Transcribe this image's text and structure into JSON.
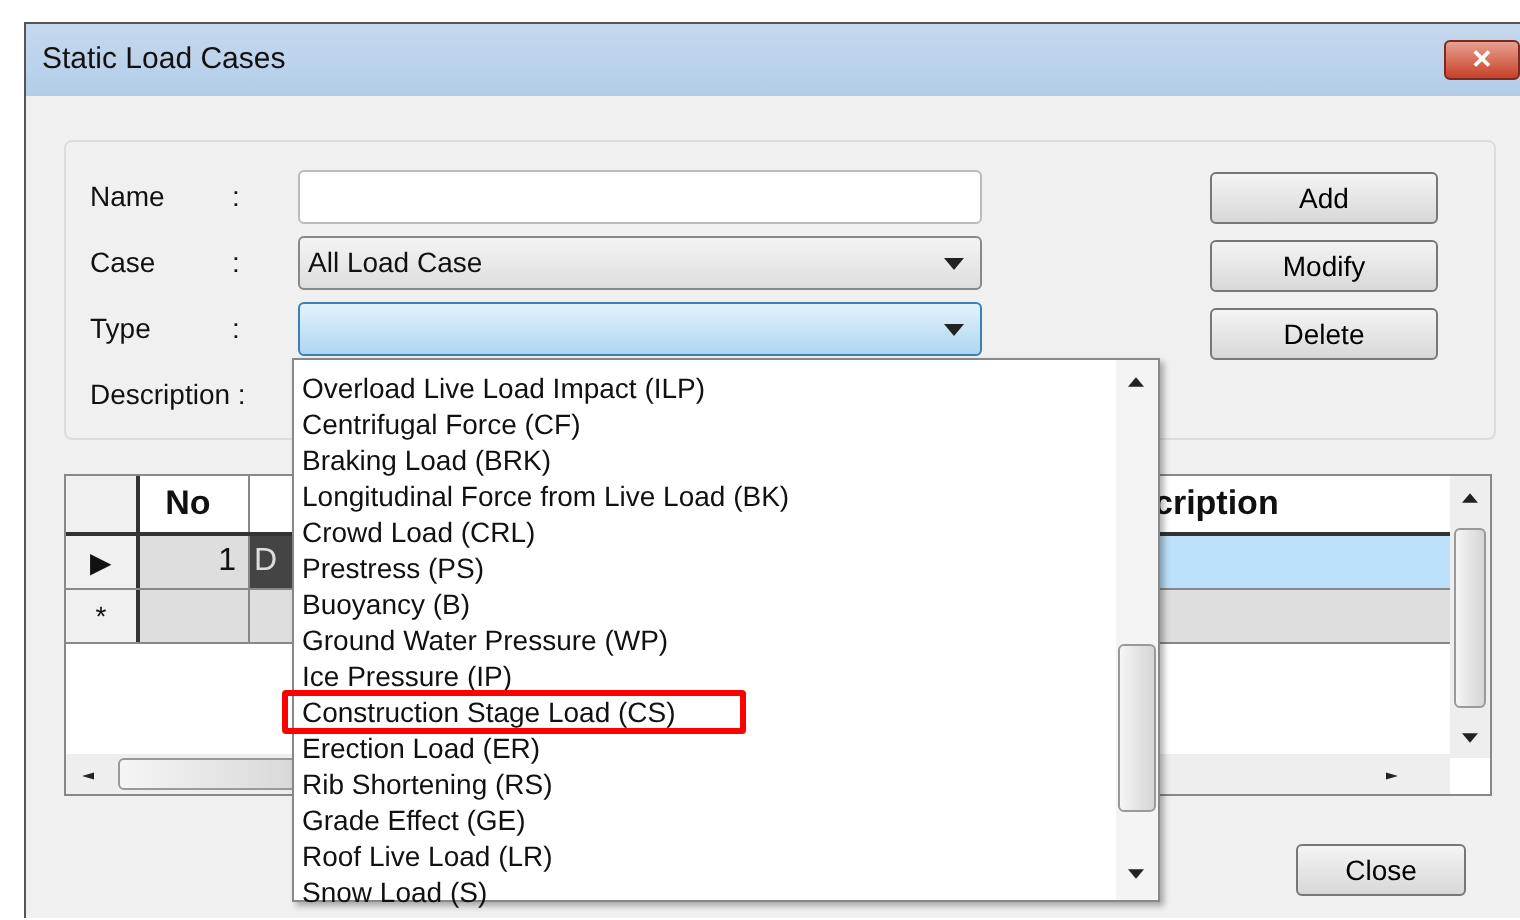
{
  "window": {
    "title": "Static Load Cases",
    "close_glyph": "✕"
  },
  "form": {
    "fields": [
      {
        "label": "Name",
        "sep": ":",
        "kind": "text"
      },
      {
        "label": "Case",
        "sep": ":",
        "kind": "select",
        "value": "All Load Case"
      },
      {
        "label": "Type",
        "sep": ":",
        "kind": "select",
        "open": true
      },
      {
        "label": "Description :",
        "kind": "covered"
      }
    ],
    "buttons": [
      "Add",
      "Modify",
      "Delete"
    ]
  },
  "grid": {
    "columns": [
      "No",
      "cription"
    ],
    "rows": [
      {
        "kind": "data",
        "selector": "▶",
        "no": "1",
        "name": "D",
        "selected": true
      },
      {
        "kind": "new",
        "selector": "*",
        "selected": false
      }
    ]
  },
  "type_dropdown": {
    "items": [
      {
        "label": "Overload Live Load Impact (ILP)",
        "highlighted": false
      },
      {
        "label": "Centrifugal Force (CF)",
        "highlighted": false
      },
      {
        "label": "Braking Load (BRK)",
        "highlighted": false
      },
      {
        "label": "Longitudinal Force from Live Load (BK)",
        "highlighted": false
      },
      {
        "label": "Crowd Load (CRL)",
        "highlighted": false
      },
      {
        "label": "Prestress (PS)",
        "highlighted": false
      },
      {
        "label": "Buoyancy (B)",
        "highlighted": false
      },
      {
        "label": "Ground Water Pressure (WP)",
        "highlighted": false
      },
      {
        "label": "Ice Pressure (IP)",
        "highlighted": false
      },
      {
        "label": "Construction Stage Load (CS)",
        "highlighted": true
      },
      {
        "label": "Erection Load (ER)",
        "highlighted": false
      },
      {
        "label": "Rib Shortening (RS)",
        "highlighted": false
      },
      {
        "label": "Grade Effect (GE)",
        "highlighted": false
      },
      {
        "label": "Roof Live Load (LR)",
        "highlighted": false
      },
      {
        "label": "Snow Load (S)",
        "highlighted": false
      }
    ]
  },
  "close_button": "Close"
}
